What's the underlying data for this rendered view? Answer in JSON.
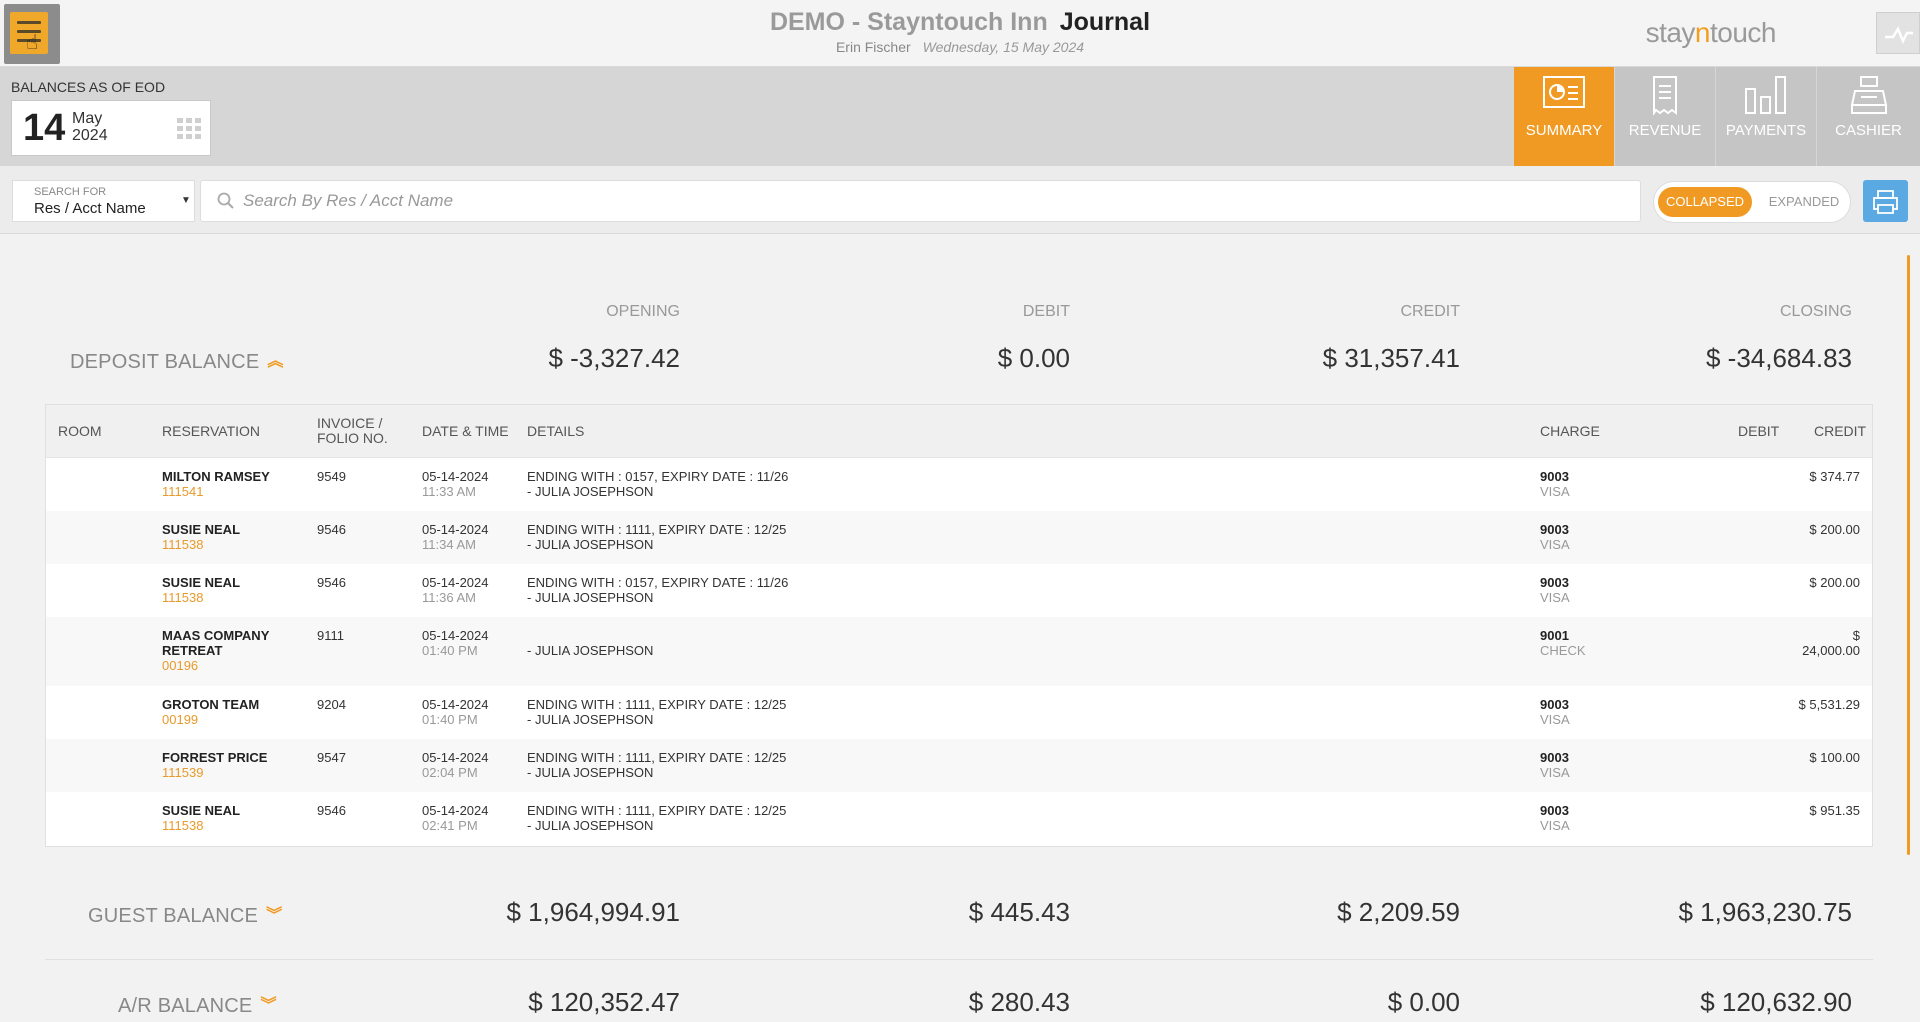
{
  "header": {
    "hotel": "DEMO - Stayntouch Inn",
    "page_title": "Journal",
    "user": "Erin Fischer",
    "date": "Wednesday, 15 May 2024",
    "logo_left": "stay",
    "logo_mid": "n",
    "logo_right": "touch"
  },
  "balances_bar": {
    "label": "BALANCES AS OF EOD",
    "day": "14",
    "month": "May",
    "year": "2024"
  },
  "tabs": [
    {
      "label": "SUMMARY",
      "icon": "summary-chart-icon",
      "active": true
    },
    {
      "label": "REVENUE",
      "icon": "receipt-icon",
      "active": false
    },
    {
      "label": "PAYMENTS",
      "icon": "bar-chart-icon",
      "active": false
    },
    {
      "label": "CASHIER",
      "icon": "cash-register-icon",
      "active": false
    }
  ],
  "search": {
    "for_caption": "SEARCH FOR",
    "for_value": "Res / Acct Name",
    "placeholder": "Search By Res / Acct Name",
    "value": ""
  },
  "view_toggle": {
    "collapsed": "COLLAPSED",
    "expanded": "EXPANDED",
    "selected": "COLLAPSED"
  },
  "columns": {
    "opening": "OPENING",
    "debit": "DEBIT",
    "credit": "CREDIT",
    "closing": "CLOSING"
  },
  "balances": [
    {
      "name": "DEPOSIT BALANCE",
      "chevron": "chevron-up-icon",
      "opening": "$ -3,327.42",
      "debit": "$ 0.00",
      "credit": "$ 31,357.41",
      "closing": "$ -34,684.83"
    },
    {
      "name": "GUEST BALANCE",
      "chevron": "chevron-down-icon",
      "opening": "$ 1,964,994.91",
      "debit": "$ 445.43",
      "credit": "$ 2,209.59",
      "closing": "$ 1,963,230.75"
    },
    {
      "name": "A/R BALANCE",
      "chevron": "chevron-down-icon",
      "opening": "$ 120,352.47",
      "debit": "$ 280.43",
      "credit": "$ 0.00",
      "closing": "$ 120,632.90"
    }
  ],
  "table": {
    "headers": {
      "room": "ROOM",
      "reservation": "RESERVATION",
      "invoice_1": "INVOICE /",
      "invoice_2": "FOLIO NO.",
      "datetime": "DATE & TIME",
      "details": "DETAILS",
      "charge": "CHARGE",
      "debit": "DEBIT",
      "credit": "CREDIT"
    },
    "rows": [
      {
        "name": "MILTON RAMSEY",
        "name2": "",
        "res": "111541",
        "folio": "9549",
        "date": "05-14-2024",
        "time": "11:33 AM",
        "detail1": "ENDING WITH : 0157, EXPIRY DATE : 11/26",
        "detail2": "- JULIA JOSEPHSON",
        "charge_code": "9003",
        "charge_type": "VISA",
        "debit": "",
        "credit": "$ 374.77",
        "credit2": ""
      },
      {
        "name": "SUSIE NEAL",
        "name2": "",
        "res": "111538",
        "folio": "9546",
        "date": "05-14-2024",
        "time": "11:34 AM",
        "detail1": "ENDING WITH : 1111, EXPIRY DATE : 12/25",
        "detail2": "- JULIA JOSEPHSON",
        "charge_code": "9003",
        "charge_type": "VISA",
        "debit": "",
        "credit": "$ 200.00",
        "credit2": ""
      },
      {
        "name": "SUSIE NEAL",
        "name2": "",
        "res": "111538",
        "folio": "9546",
        "date": "05-14-2024",
        "time": "11:36 AM",
        "detail1": "ENDING WITH : 0157, EXPIRY DATE : 11/26",
        "detail2": "- JULIA JOSEPHSON",
        "charge_code": "9003",
        "charge_type": "VISA",
        "debit": "",
        "credit": "$ 200.00",
        "credit2": ""
      },
      {
        "name": "MAAS COMPANY",
        "name2": "RETREAT",
        "res": "00196",
        "folio": "9111",
        "date": "05-14-2024",
        "time": "01:40 PM",
        "detail1": "",
        "detail2": "- JULIA JOSEPHSON",
        "charge_code": "9001",
        "charge_type": "CHECK",
        "debit": "",
        "credit": "$",
        "credit2": "24,000.00"
      },
      {
        "name": "GROTON TEAM",
        "name2": "",
        "res": "00199",
        "folio": "9204",
        "date": "05-14-2024",
        "time": "01:40 PM",
        "detail1": "ENDING WITH : 1111, EXPIRY DATE : 12/25",
        "detail2": "- JULIA JOSEPHSON",
        "charge_code": "9003",
        "charge_type": "VISA",
        "debit": "",
        "credit": "$ 5,531.29",
        "credit2": ""
      },
      {
        "name": "FORREST PRICE",
        "name2": "",
        "res": "111539",
        "folio": "9547",
        "date": "05-14-2024",
        "time": "02:04 PM",
        "detail1": "ENDING WITH : 1111, EXPIRY DATE : 12/25",
        "detail2": "- JULIA JOSEPHSON",
        "charge_code": "9003",
        "charge_type": "VISA",
        "debit": "",
        "credit": "$ 100.00",
        "credit2": ""
      },
      {
        "name": "SUSIE NEAL",
        "name2": "",
        "res": "111538",
        "folio": "9546",
        "date": "05-14-2024",
        "time": "02:41 PM",
        "detail1": "ENDING WITH : 1111, EXPIRY DATE : 12/25",
        "detail2": "- JULIA JOSEPHSON",
        "charge_code": "9003",
        "charge_type": "VISA",
        "debit": "",
        "credit": "$ 951.35",
        "credit2": ""
      }
    ]
  },
  "colors": {
    "accent": "#f19a23",
    "print_button": "#5aa9e2",
    "reservation_link": "#e89a2a"
  }
}
